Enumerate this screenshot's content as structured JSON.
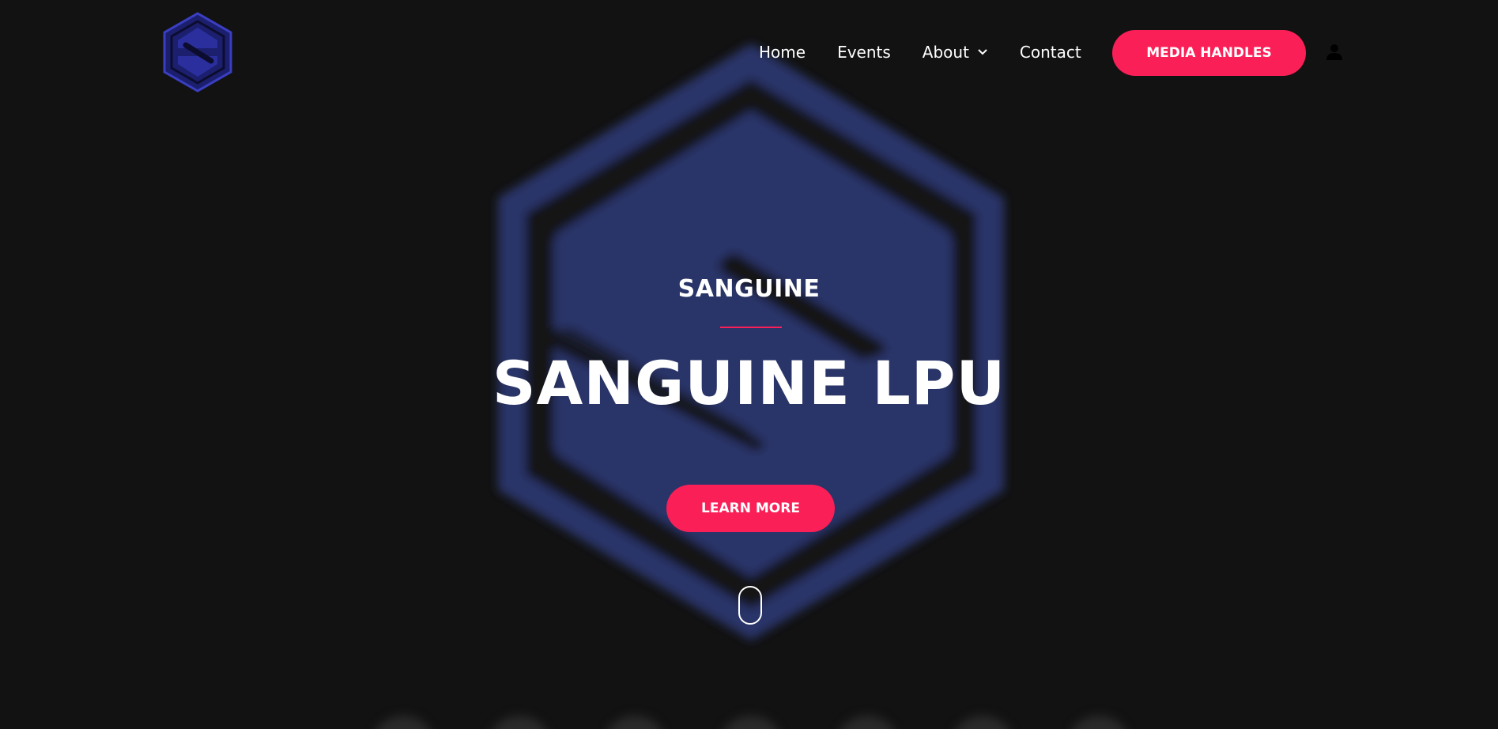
{
  "header": {
    "nav": {
      "home": "Home",
      "events": "Events",
      "about": "About",
      "contact": "Contact"
    },
    "media_button": "MEDIA HANDLES",
    "user_icon": "user-icon",
    "logo_icon": "hexagon-s-logo"
  },
  "hero": {
    "subtitle": "SANGUINE",
    "title": "SANGUINE LPU",
    "cta": "LEARN MORE",
    "scroll_icon": "mouse-scroll-icon"
  },
  "colors": {
    "background": "#121212",
    "accent": "#fb1f57",
    "logo_blue": "#2d3a78",
    "text": "#ffffff"
  }
}
